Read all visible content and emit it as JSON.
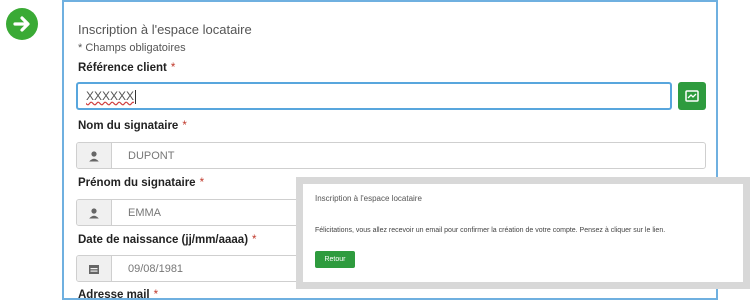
{
  "form": {
    "title": "Inscription à l'espace locataire",
    "required_note": "* Champs obligatoires",
    "reference": {
      "label": "Référence client",
      "required_mark": "*",
      "value": "XXXXXX"
    },
    "nom": {
      "label": "Nom du signataire",
      "required_mark": "*",
      "value": "DUPONT",
      "icon": "user-icon"
    },
    "prenom": {
      "label": "Prénom du signataire",
      "required_mark": "*",
      "value": "EMMA",
      "icon": "user-icon"
    },
    "naissance": {
      "label": "Date de naissance (jj/mm/aaaa)",
      "required_mark": "*",
      "value": "09/08/1981",
      "icon": "calendar-icon"
    },
    "email": {
      "label": "Adresse mail",
      "required_mark": "*"
    }
  },
  "modal": {
    "title": "Inscription à l'espace locataire",
    "message": "Félicitations, vous allez recevoir un email pour confirmer la création de votre compte. Pensez à cliquer sur le lien.",
    "button_label": "Retour"
  },
  "colors": {
    "accent_green": "#2e9b3e",
    "focus_blue": "#58a6dd",
    "panel_border": "#6fb0e0"
  }
}
